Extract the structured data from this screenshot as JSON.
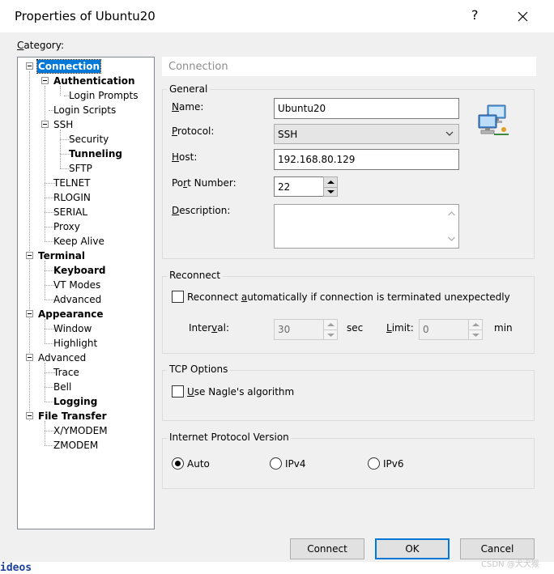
{
  "window": {
    "title": "Properties of Ubuntu20",
    "help_glyph": "?",
    "category_prefix": "C",
    "category_rest": "ategory:"
  },
  "tree": {
    "connection": "Connection",
    "authentication": "Authentication",
    "login_prompts": "Login Prompts",
    "login_scripts": "Login Scripts",
    "ssh": "SSH",
    "security": "Security",
    "tunneling": "Tunneling",
    "sftp": "SFTP",
    "telnet": "TELNET",
    "rlogin": "RLOGIN",
    "serial": "SERIAL",
    "proxy": "Proxy",
    "keep_alive": "Keep Alive",
    "terminal": "Terminal",
    "keyboard": "Keyboard",
    "vt_modes": "VT Modes",
    "advanced_term": "Advanced",
    "appearance": "Appearance",
    "window": "Window",
    "highlight": "Highlight",
    "advanced": "Advanced",
    "trace": "Trace",
    "bell": "Bell",
    "logging": "Logging",
    "file_transfer": "File Transfer",
    "xymodem": "X/YMODEM",
    "zmodem": "ZMODEM"
  },
  "panel": {
    "header": "Connection",
    "general": {
      "title": "General",
      "name_u": "N",
      "name_rest": "ame:",
      "name_value": "Ubuntu20",
      "protocol_u": "P",
      "protocol_rest": "rotocol:",
      "protocol_value": "SSH",
      "host_u": "H",
      "host_rest": "ost:",
      "host_value": "192.168.80.129",
      "port_pre": "Po",
      "port_u": "r",
      "port_rest": "t Number:",
      "port_value": "22",
      "desc_u": "D",
      "desc_rest": "escription:"
    },
    "reconnect": {
      "title": "Reconnect",
      "checkbox_pre": "Reconnect ",
      "checkbox_u": "a",
      "checkbox_rest": "utomatically if connection is terminated unexpectedly",
      "interval_pre": "Inter",
      "interval_u": "v",
      "interval_rest": "al:",
      "interval_value": "30",
      "interval_unit": "sec",
      "limit_u": "L",
      "limit_rest": "imit:",
      "limit_value": "0",
      "limit_unit": "min"
    },
    "tcp": {
      "title": "TCP Options",
      "nagle_u": "U",
      "nagle_rest": "se Nagle's algorithm"
    },
    "ipv": {
      "title": "Internet Protocol Version",
      "auto": "Auto",
      "ipv4": "IPv4",
      "ipv6": "IPv6"
    }
  },
  "buttons": {
    "connect": "Connect",
    "ok": "OK",
    "cancel": "Cancel"
  },
  "watermark": "CSDN @犬犬猴",
  "bottom_text": "ideos",
  "colors": {
    "accent": "#0078d7",
    "panel_bg": "#f0f0f0"
  }
}
